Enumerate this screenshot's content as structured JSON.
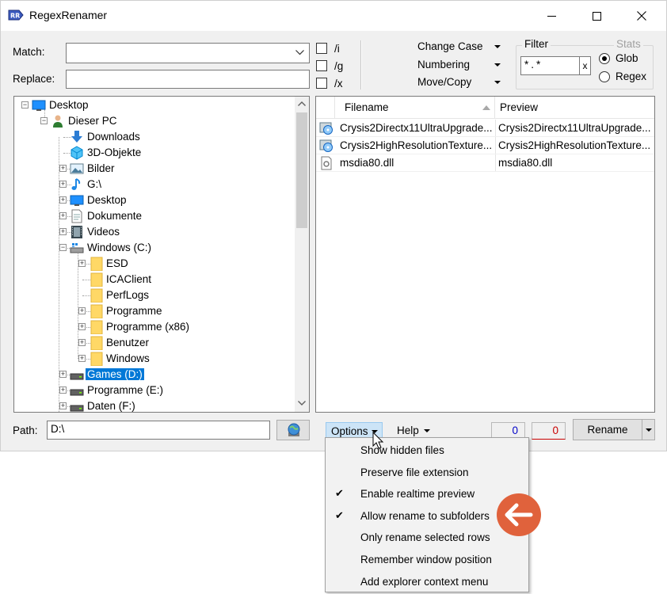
{
  "window": {
    "title": "RegexRenamer",
    "app_icon_text": "RR",
    "controls": {
      "minimize": "—",
      "maximize": "☐",
      "close": "✕"
    }
  },
  "match": {
    "label": "Match:",
    "value": ""
  },
  "replace": {
    "label": "Replace:",
    "value": ""
  },
  "flags": [
    {
      "label": "/i",
      "checked": false
    },
    {
      "label": "/g",
      "checked": false
    },
    {
      "label": "/x",
      "checked": false
    }
  ],
  "menus": {
    "change_case": "Change Case",
    "numbering": "Numbering",
    "move_copy": "Move/Copy"
  },
  "filter": {
    "legend": "Filter",
    "value": "*.*",
    "clear_label": "x",
    "stats_label": "Stats",
    "options": [
      {
        "label": "Glob",
        "selected": true
      },
      {
        "label": "Regex",
        "selected": false
      }
    ]
  },
  "tree": {
    "items": [
      {
        "label": "Desktop",
        "icon": "desktop-icon",
        "level": 0,
        "expander": "-"
      },
      {
        "label": "Dieser PC",
        "icon": "user-icon",
        "level": 1,
        "expander": "-"
      },
      {
        "label": "Downloads",
        "icon": "download-icon",
        "level": 2,
        "expander": ""
      },
      {
        "label": "3D-Objekte",
        "icon": "cube-icon",
        "level": 2,
        "expander": ""
      },
      {
        "label": "Bilder",
        "icon": "pictures-icon",
        "level": 2,
        "expander": "+"
      },
      {
        "label": "G:\\",
        "icon": "music-icon",
        "level": 2,
        "expander": "+"
      },
      {
        "label": "Desktop",
        "icon": "desktop-icon",
        "level": 2,
        "expander": "+"
      },
      {
        "label": "Dokumente",
        "icon": "document-icon",
        "level": 2,
        "expander": "+"
      },
      {
        "label": "Videos",
        "icon": "video-icon",
        "level": 2,
        "expander": "+"
      },
      {
        "label": "Windows (C:)",
        "icon": "system-drive-icon",
        "level": 2,
        "expander": "-"
      },
      {
        "label": "ESD",
        "icon": "folder-icon",
        "level": 3,
        "expander": "+"
      },
      {
        "label": "ICAClient",
        "icon": "folder-icon",
        "level": 3,
        "expander": ""
      },
      {
        "label": "PerfLogs",
        "icon": "folder-icon",
        "level": 3,
        "expander": ""
      },
      {
        "label": "Programme",
        "icon": "folder-icon",
        "level": 3,
        "expander": "+"
      },
      {
        "label": "Programme (x86)",
        "icon": "folder-icon",
        "level": 3,
        "expander": "+"
      },
      {
        "label": "Benutzer",
        "icon": "folder-icon",
        "level": 3,
        "expander": "+"
      },
      {
        "label": "Windows",
        "icon": "folder-icon",
        "level": 3,
        "expander": "+"
      },
      {
        "label": "Games (D:)",
        "icon": "drive-icon",
        "level": 2,
        "expander": "+",
        "selected": true
      },
      {
        "label": "Programme (E:)",
        "icon": "drive-icon",
        "level": 2,
        "expander": "+"
      },
      {
        "label": "Daten (F:)",
        "icon": "drive-icon",
        "level": 2,
        "expander": "+"
      }
    ]
  },
  "filelist": {
    "columns": {
      "filename": "Filename",
      "preview": "Preview"
    },
    "rows": [
      {
        "filename": "Crysis2Directx11UltraUpgrade...",
        "preview": "Crysis2Directx11UltraUpgrade...",
        "icon": "installer-icon"
      },
      {
        "filename": "Crysis2HighResolutionTexture...",
        "preview": "Crysis2HighResolutionTexture...",
        "icon": "installer-icon"
      },
      {
        "filename": "msdia80.dll",
        "preview": "msdia80.dll",
        "icon": "dll-icon"
      }
    ]
  },
  "path": {
    "label": "Path:",
    "value": "D:\\"
  },
  "bottom": {
    "options_label": "Options",
    "help_label": "Help",
    "count_matched": "0",
    "count_errors": "0",
    "rename_label": "Rename"
  },
  "options_menu": {
    "check_glyph": "✔",
    "items": [
      {
        "label": "Show hidden files",
        "checked": false
      },
      {
        "label": "Preserve file extension",
        "checked": false
      },
      {
        "label": "Enable realtime preview",
        "checked": true
      },
      {
        "label": "Allow rename to subfolders",
        "checked": true
      },
      {
        "label": "Only rename selected rows",
        "checked": false
      },
      {
        "label": "Remember window position",
        "checked": false
      },
      {
        "label": "Add explorer context menu",
        "checked": false
      }
    ]
  },
  "colors": {
    "selection": "#0078d7",
    "annotation_arrow": "#e0623c",
    "count_matched": "#0000c8",
    "count_errors": "#c80000"
  }
}
